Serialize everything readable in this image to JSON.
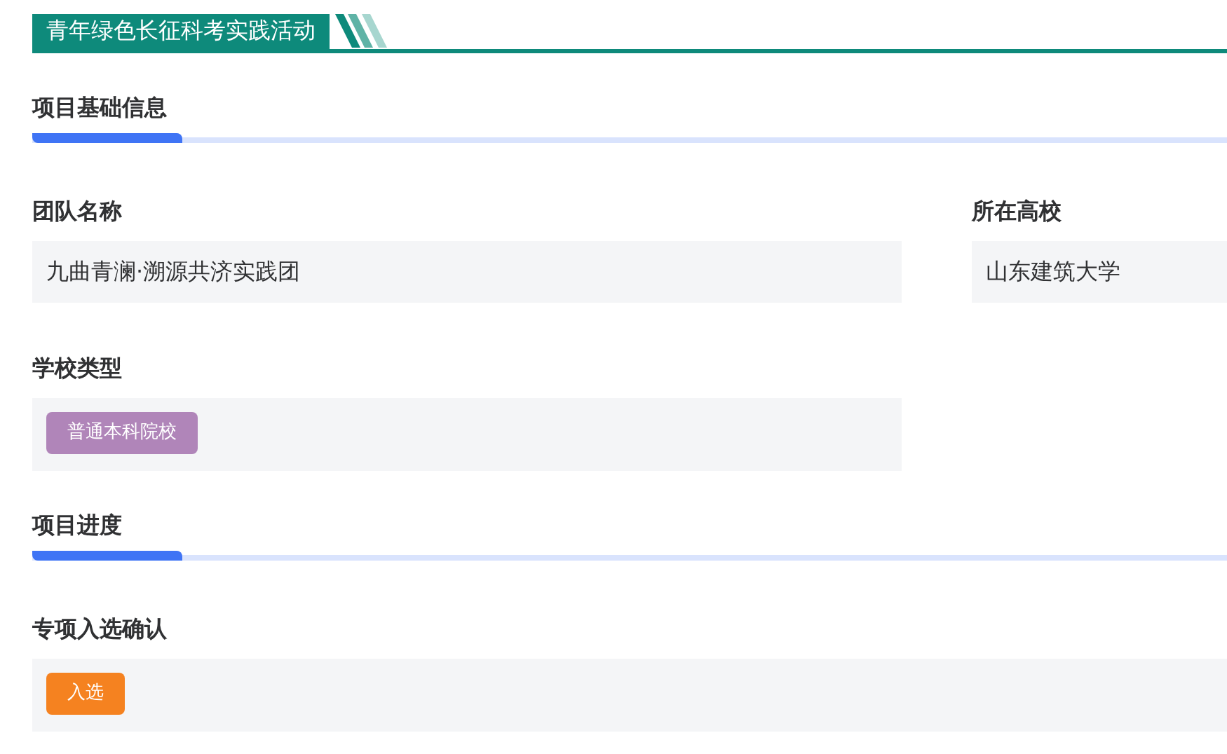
{
  "header": {
    "title": "青年绿色长征科考实践活动"
  },
  "sections": [
    {
      "title": "项目基础信息",
      "fields": [
        {
          "label": "团队名称",
          "kind": "text",
          "value": "九曲青澜·溯源共济实践团"
        },
        {
          "label": "所在高校",
          "kind": "text",
          "value": "山东建筑大学"
        },
        {
          "label": "学校类型",
          "kind": "tag",
          "value": "普通本科院校",
          "color": "#b085b9"
        }
      ]
    },
    {
      "title": "项目进度",
      "fields": [
        {
          "label": "专项入选确认",
          "kind": "tag",
          "value": "入选",
          "color": "#f58220"
        }
      ]
    }
  ]
}
